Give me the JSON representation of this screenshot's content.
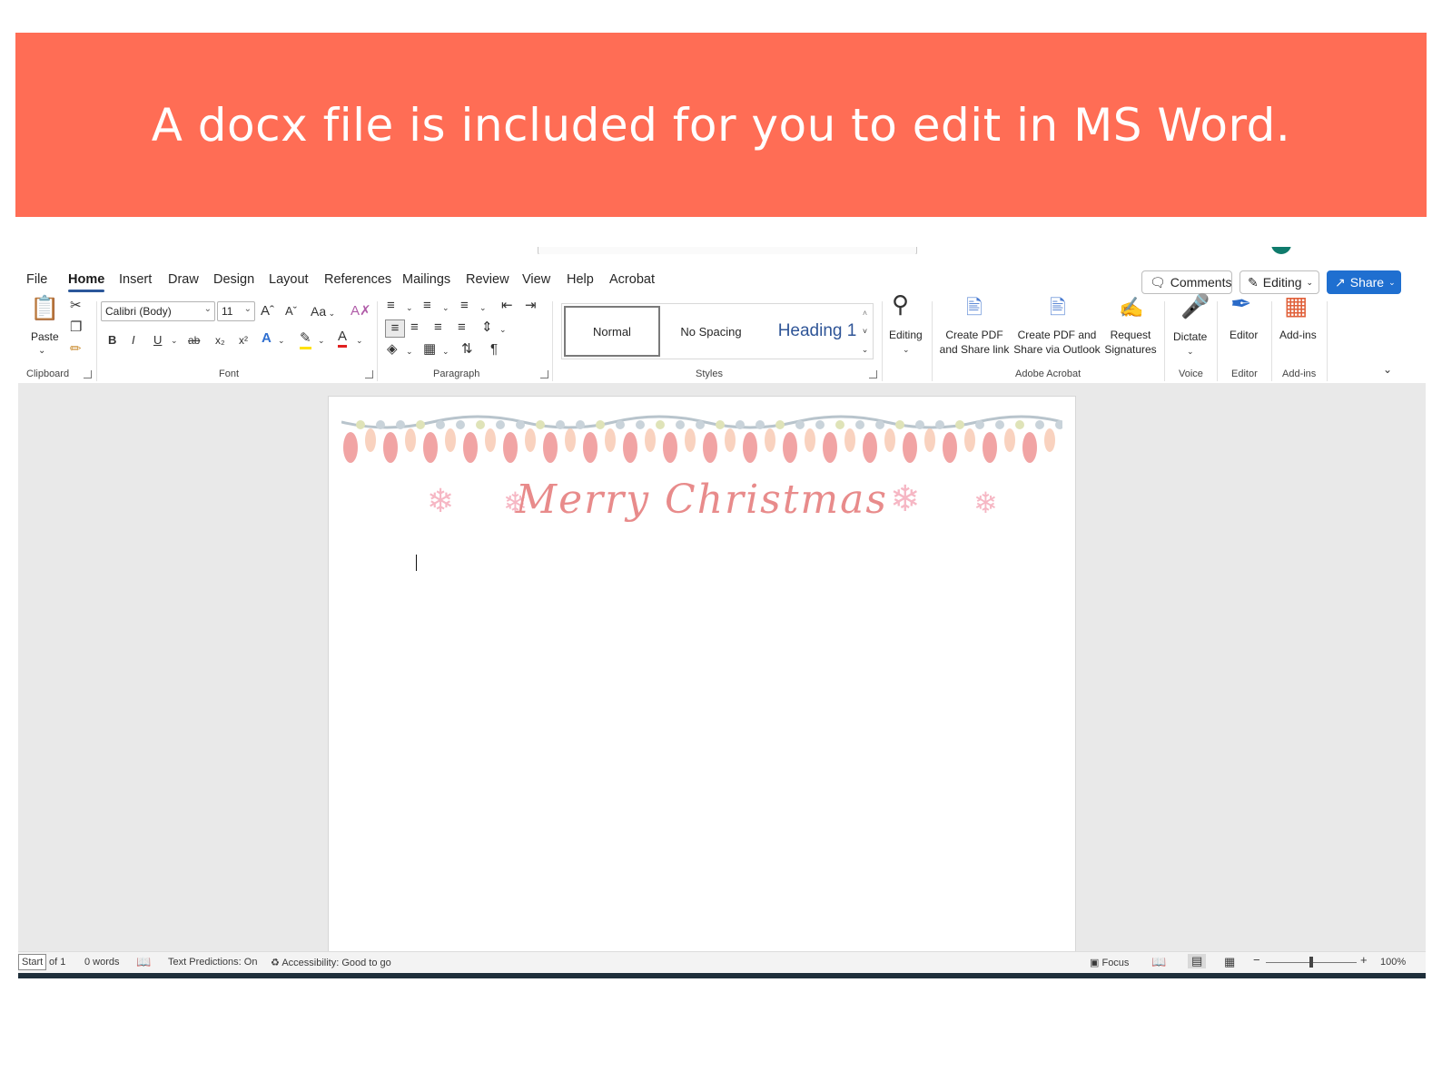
{
  "banner": {
    "text": "A docx file is included for you to edit in MS Word."
  },
  "menu": {
    "tabs": [
      "File",
      "Home",
      "Insert",
      "Draw",
      "Design",
      "Layout",
      "References",
      "Mailings",
      "Review",
      "View",
      "Help",
      "Acrobat"
    ],
    "active_tab": "Home",
    "comments_label": "Comments",
    "editing_label": "Editing",
    "share_label": "Share"
  },
  "ribbon": {
    "clipboard": {
      "paste_label": "Paste",
      "group_label": "Clipboard"
    },
    "font": {
      "family": "Calibri (Body)",
      "size": "11",
      "case_label": "Aa",
      "group_label": "Font"
    },
    "paragraph": {
      "group_label": "Paragraph"
    },
    "styles": {
      "items": [
        "Normal",
        "No Spacing",
        "Heading 1"
      ],
      "selected": "Normal",
      "group_label": "Styles"
    },
    "editing": {
      "label": "Editing"
    },
    "acrobat": {
      "create_pdf_share_link": [
        "Create PDF",
        "and Share link"
      ],
      "create_pdf_outlook": [
        "Create PDF and",
        "Share via Outlook"
      ],
      "request_signatures": [
        "Request",
        "Signatures"
      ],
      "group_label": "Adobe Acrobat"
    },
    "voice": {
      "dictate_label": "Dictate",
      "group_label": "Voice"
    },
    "editor": {
      "label": "Editor",
      "group_label": "Editor"
    },
    "addins": {
      "label": "Add-ins",
      "group_label": "Add-ins"
    }
  },
  "document": {
    "greeting": "Merry Christmas"
  },
  "status": {
    "start": "Start",
    "page": "of 1",
    "words": "0 words",
    "text_predictions": "Text Predictions: On",
    "accessibility": "Accessibility: Good to go",
    "focus": "Focus",
    "zoom": "100%"
  },
  "colors": {
    "banner": "#ff6d55",
    "accent": "#2b579a",
    "share": "#1f6fd0",
    "greeting": "#e88b8b"
  }
}
